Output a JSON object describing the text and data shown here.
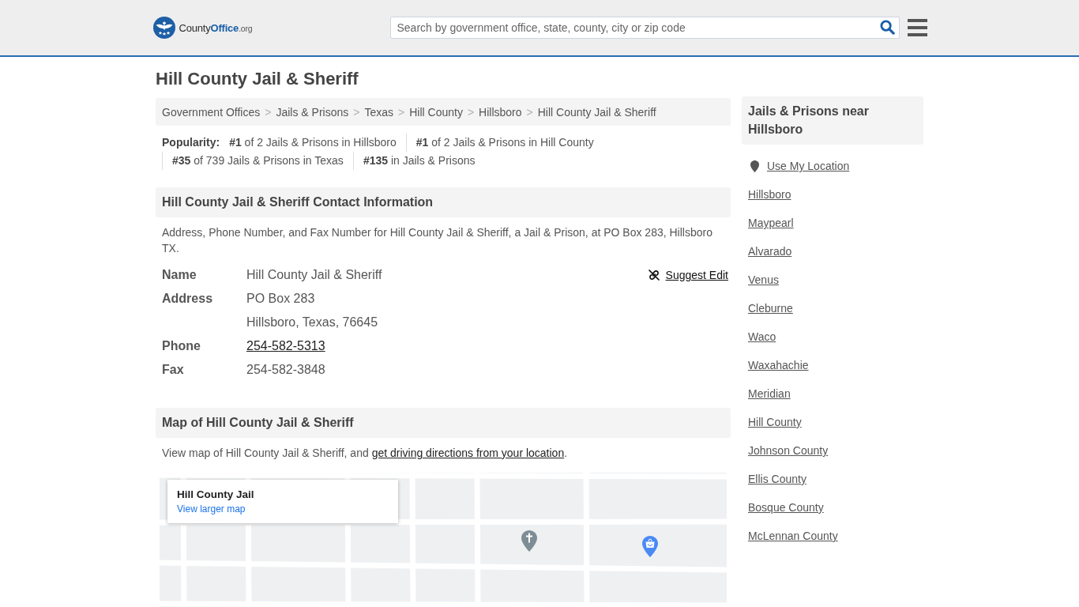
{
  "header": {
    "logo": {
      "name": "County",
      "name_accent": "Office",
      "domain": ".org"
    },
    "search": {
      "placeholder": "Search by government office, state, county, city or zip code"
    }
  },
  "page_title": "Hill County Jail & Sheriff",
  "breadcrumbs": {
    "separator": ">",
    "items": [
      "Government Offices",
      "Jails & Prisons",
      "Texas",
      "Hill County",
      "Hillsboro",
      "Hill County Jail & Sheriff"
    ]
  },
  "popularity": {
    "label": "Popularity:",
    "ranks": [
      "**#1** of 2 Jails & Prisons in Hillsboro",
      "**#1** of 2 Jails & Prisons in Hill County",
      "**#35** of 739 Jails & Prisons in Texas",
      "**#135** in Jails & Prisons"
    ]
  },
  "contact": {
    "heading": "Hill County Jail & Sheriff Contact Information",
    "description": "Address, Phone Number, and Fax Number for Hill County Jail & Sheriff, a Jail & Prison, at PO Box 283, Hillsboro TX.",
    "suggest_edit": "Suggest Edit",
    "fields": [
      {
        "label": "Name",
        "values": [
          {
            "kind": "text",
            "text": "Hill County Jail & Sheriff"
          }
        ]
      },
      {
        "label": "Address",
        "values": [
          {
            "kind": "text",
            "text": "PO Box 283"
          },
          {
            "kind": "text",
            "text": "Hillsboro, Texas, 76645"
          }
        ]
      },
      {
        "label": "Phone",
        "values": [
          {
            "kind": "link",
            "text": "254-582-5313"
          }
        ]
      },
      {
        "label": "Fax",
        "values": [
          {
            "kind": "text",
            "text": "254-582-3848"
          }
        ]
      }
    ]
  },
  "map": {
    "heading": "Map of Hill County Jail & Sheriff",
    "intro": "View map of Hill County Jail & Sheriff, and ",
    "directions_link": "get driving directions from your location",
    "intro_end": ".",
    "info_card": {
      "title": "Hill County Jail",
      "link": "View larger map"
    }
  },
  "sidebar": {
    "heading": "Jails & Prisons near Hillsboro",
    "location_link": "Use My Location",
    "links": [
      "Hillsboro",
      "Maypearl",
      "Alvarado",
      "Venus",
      "Cleburne",
      "Waco",
      "Waxahachie",
      "Meridian",
      "Hill County",
      "Johnson County",
      "Ellis County",
      "Bosque County",
      "McLennan County"
    ]
  }
}
